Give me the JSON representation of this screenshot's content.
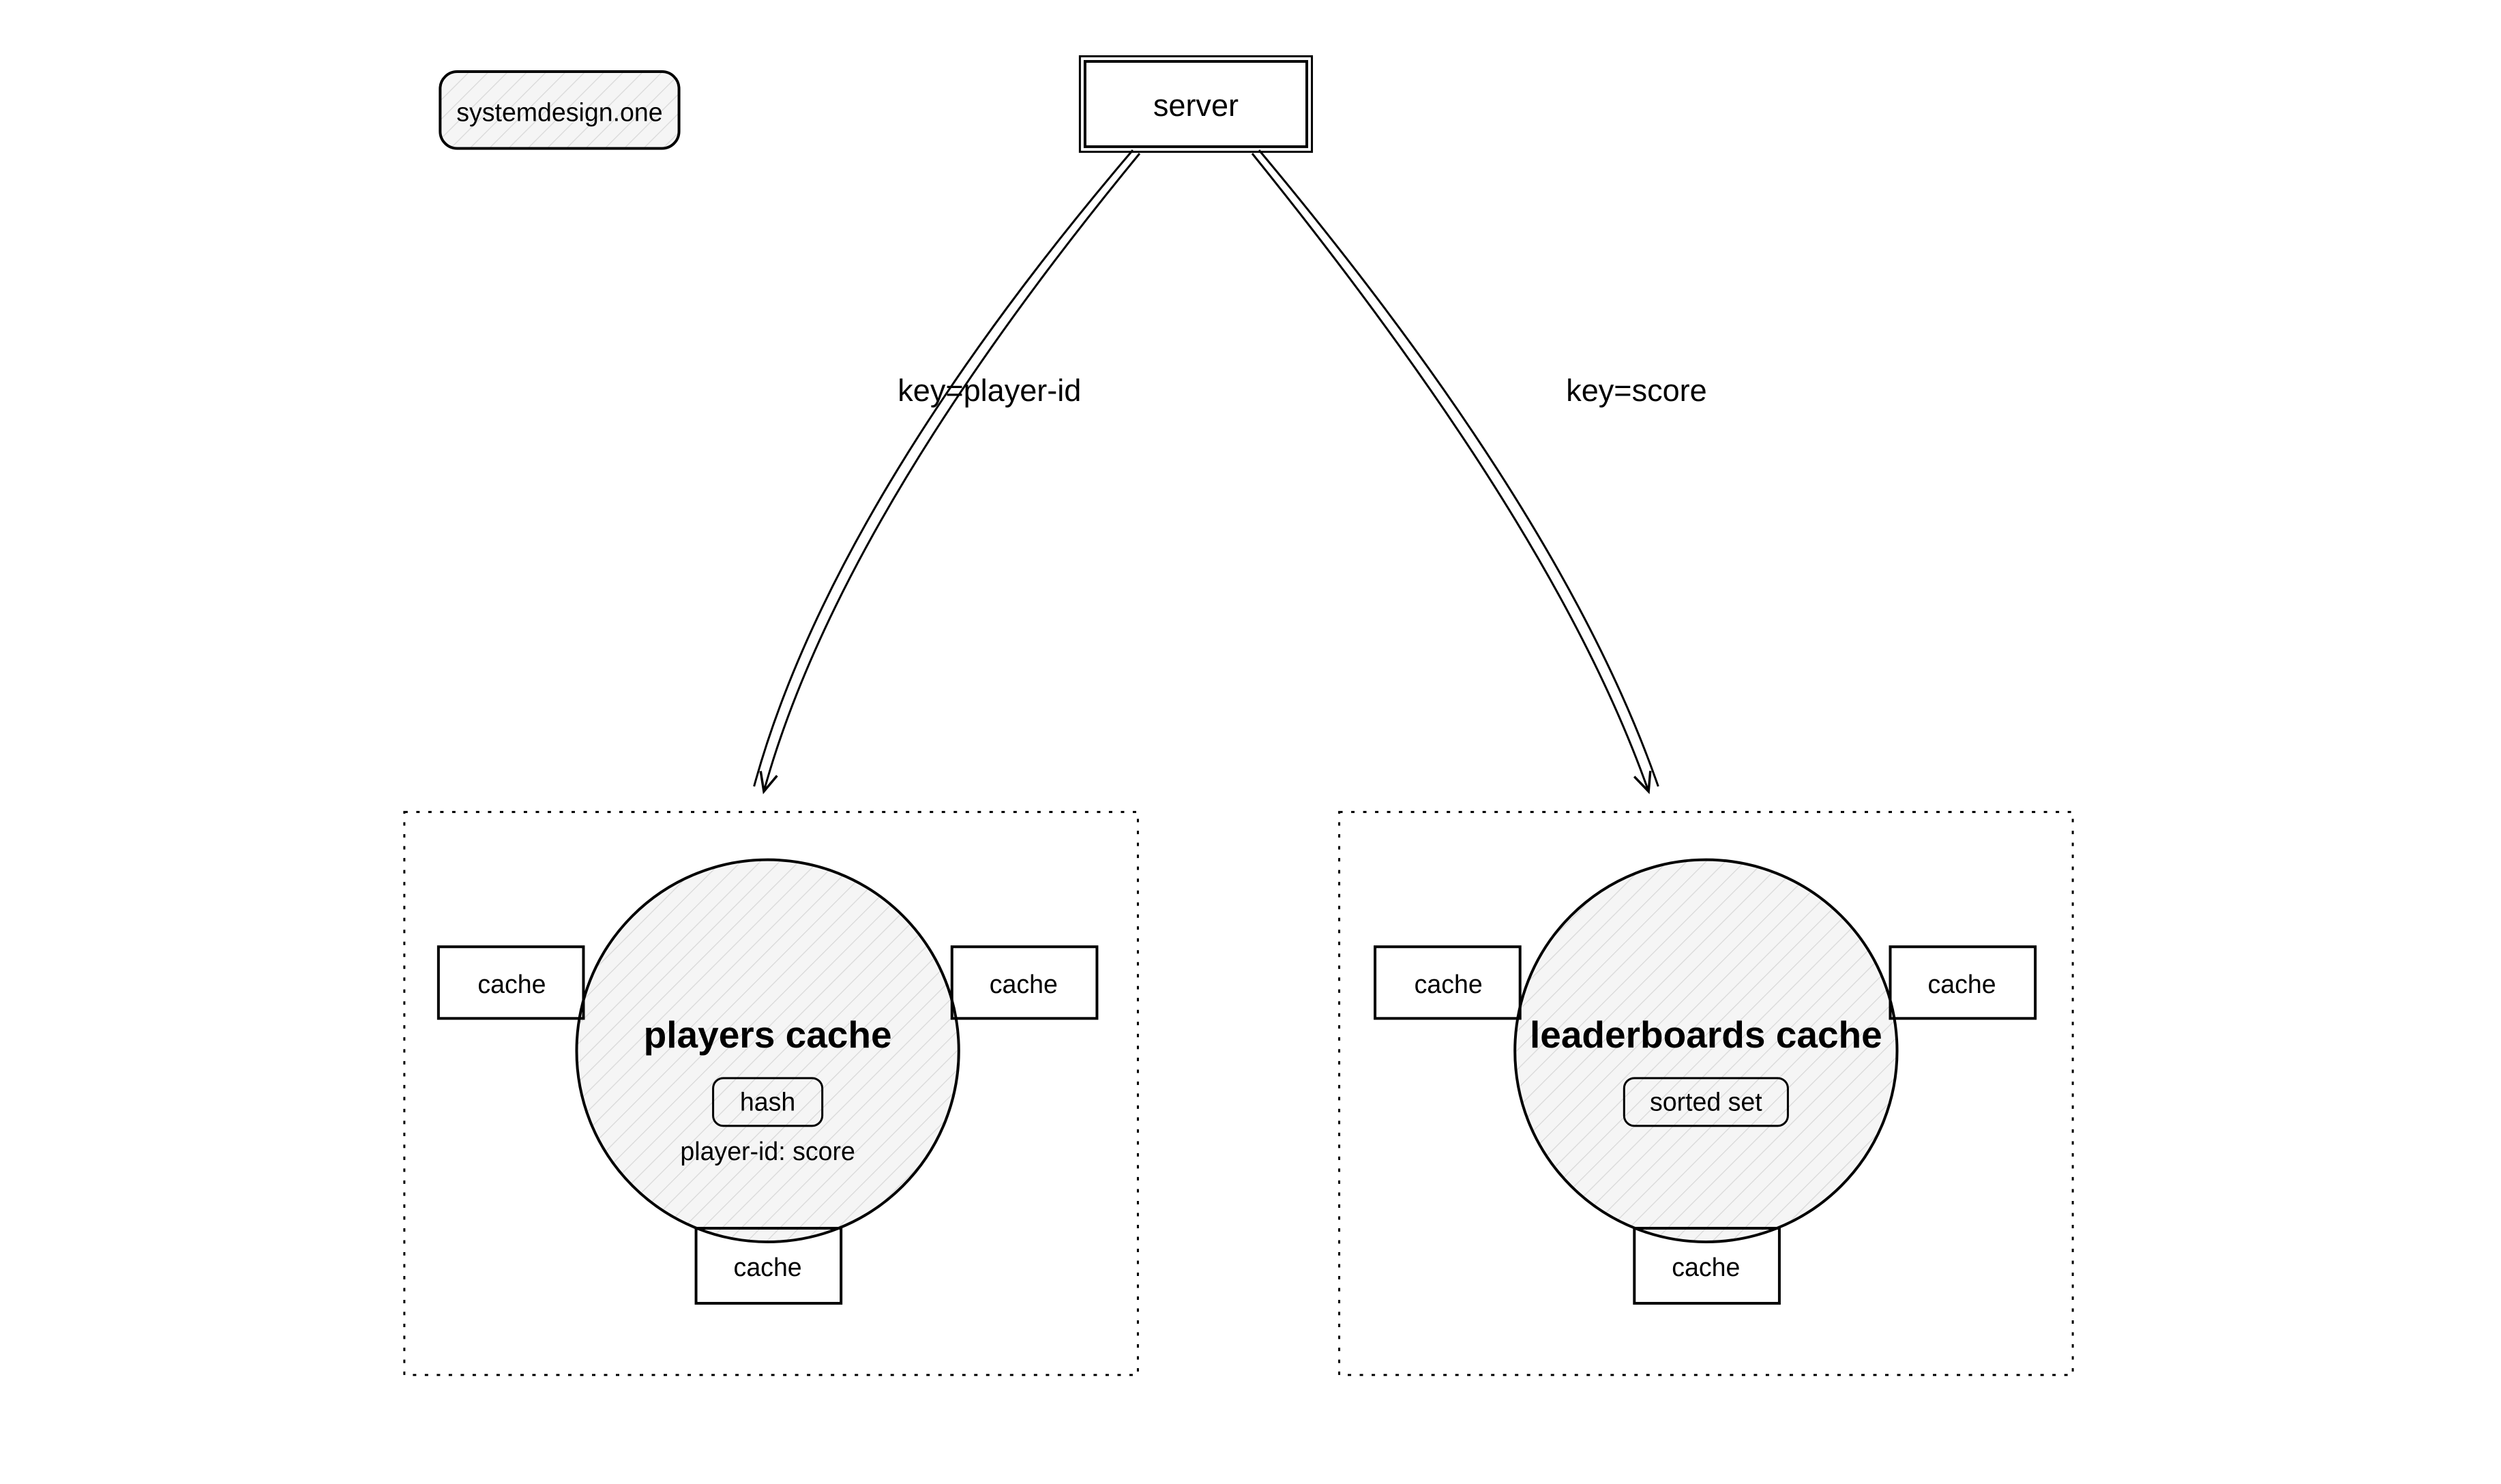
{
  "watermark": {
    "text": "systemdesign.one"
  },
  "server": {
    "label": "server"
  },
  "arrows": {
    "left": {
      "label": "key=player-id"
    },
    "right": {
      "label": "key=score"
    }
  },
  "clusters": {
    "left": {
      "circle_title": "players cache",
      "badge": "hash",
      "subtext": "player-id: score",
      "nodes": {
        "nw": "cache",
        "ne": "cache",
        "s": "cache"
      }
    },
    "right": {
      "circle_title": "leaderboards cache",
      "badge": "sorted set",
      "subtext": "",
      "nodes": {
        "nw": "cache",
        "ne": "cache",
        "s": "cache"
      }
    }
  }
}
